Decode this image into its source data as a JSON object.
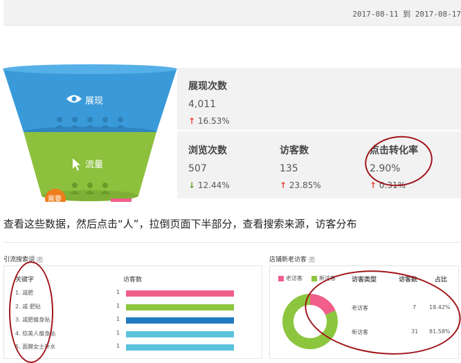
{
  "header": {
    "date_range": "2017-08-11 到 2017-08-17"
  },
  "funnel": {
    "stage1": {
      "label": "展现",
      "icon": "eye-icon"
    },
    "stage2": {
      "label": "流量",
      "icon": "cursor-icon"
    },
    "stage3": {
      "label": "需要"
    }
  },
  "metrics": {
    "impressions": {
      "label": "展现次数",
      "value": "4,011",
      "change": "16.53%",
      "direction": "up"
    },
    "pageviews": {
      "label": "浏览次数",
      "value": "507",
      "change": "12.44%",
      "direction": "down"
    },
    "visitors": {
      "label": "访客数",
      "value": "135",
      "change": "23.85%",
      "direction": "up"
    },
    "ctr": {
      "label": "点击转化率",
      "value": "2.90%",
      "change": "0.31%",
      "direction": "up"
    }
  },
  "caption": "查看这些数据，然后点击“人”，拉倒页面下半部分，查看搜索来源，访客分布",
  "keywords_card": {
    "title": "引流搜索词",
    "help": "?",
    "col_keyword": "关键字",
    "col_visitors": "访客数",
    "rows": [
      {
        "rank": "1.",
        "keyword": "减肥",
        "count": "1",
        "color": "#ef5f8a"
      },
      {
        "rank": "2.",
        "keyword": "减 肥贴",
        "count": "1",
        "color": "#8cc63f"
      },
      {
        "rank": "3.",
        "keyword": "减肥瘦身贴",
        "count": "1",
        "color": "#1f7bbf"
      },
      {
        "rank": "4.",
        "keyword": "综美人瘦身贴",
        "count": "1",
        "color": "#5bc2dc"
      },
      {
        "rank": "5.",
        "keyword": "面膜女士补水",
        "count": "1",
        "color": "#5bc2dc"
      }
    ]
  },
  "visitors_card": {
    "title": "店铺新老访客",
    "help": "?",
    "legend": [
      {
        "label": "老访客",
        "color": "#ef5f8a"
      },
      {
        "label": "新访客",
        "color": "#8cc63f"
      }
    ],
    "headers": {
      "type": "访客类型",
      "count": "访客数",
      "ratio": "占比"
    },
    "rows": [
      {
        "type": "老访客",
        "count": "7",
        "ratio": "18.42%"
      },
      {
        "type": "新访客",
        "count": "31",
        "ratio": "81.58%"
      }
    ]
  },
  "donut": {
    "old_fraction": 0.1842,
    "new_fraction": 0.8158,
    "old_color": "#ef5f8a",
    "new_color": "#8cc63f"
  },
  "colors": {
    "funnel_blue": "#3a9ad9",
    "funnel_green": "#8dc03d",
    "funnel_orange": "#ee7d1d",
    "annotation_red": "#a01418",
    "arrow_up": "#e8413c",
    "arrow_down": "#6aa32b"
  }
}
